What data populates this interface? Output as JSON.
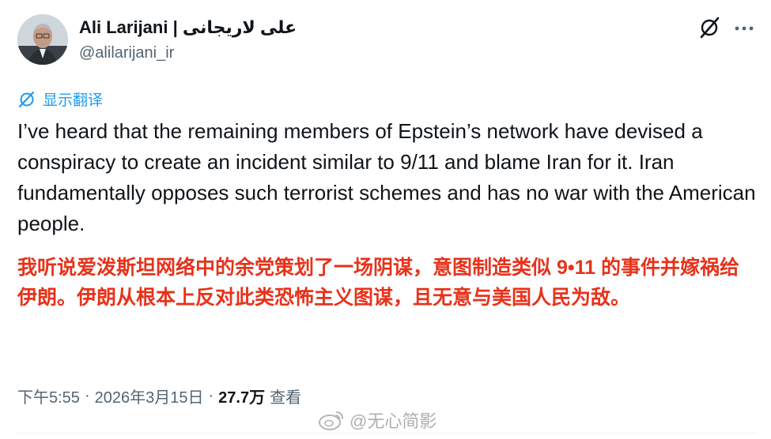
{
  "author": {
    "display_name": "Ali Larijani | علی لاریجانی",
    "handle": "@alilarijani_ir"
  },
  "header_actions": {
    "grok_icon": "grok-icon",
    "more_icon": "more-icon"
  },
  "translate": {
    "label": "显示翻译",
    "icon": "translate-icon"
  },
  "tweet": {
    "text": "I’ve heard that the remaining members of Epstein’s network have devised a conspiracy to create an incident similar to 9/11 and blame Iran for it. Iran fundamentally opposes such terrorist schemes and has no war with the American people.",
    "translation": "我听说爱泼斯坦网络中的余党策划了一场阴谋，意图制造类似 9•11 的事件并嫁祸给伊朗。伊朗从根本上反对此类恐怖主义图谋，且无意与美国人民为敌。"
  },
  "meta": {
    "time": "下午5:55",
    "separator1": "·",
    "date": "2026年3月15日",
    "separator2": "·",
    "views_count": "27.7万",
    "views_label": "查看"
  },
  "watermark": {
    "text": "@无心简影"
  },
  "colors": {
    "link": "#1d9bf0",
    "translation": "#e8321a",
    "secondary": "#536471",
    "primary": "#0f1419"
  }
}
